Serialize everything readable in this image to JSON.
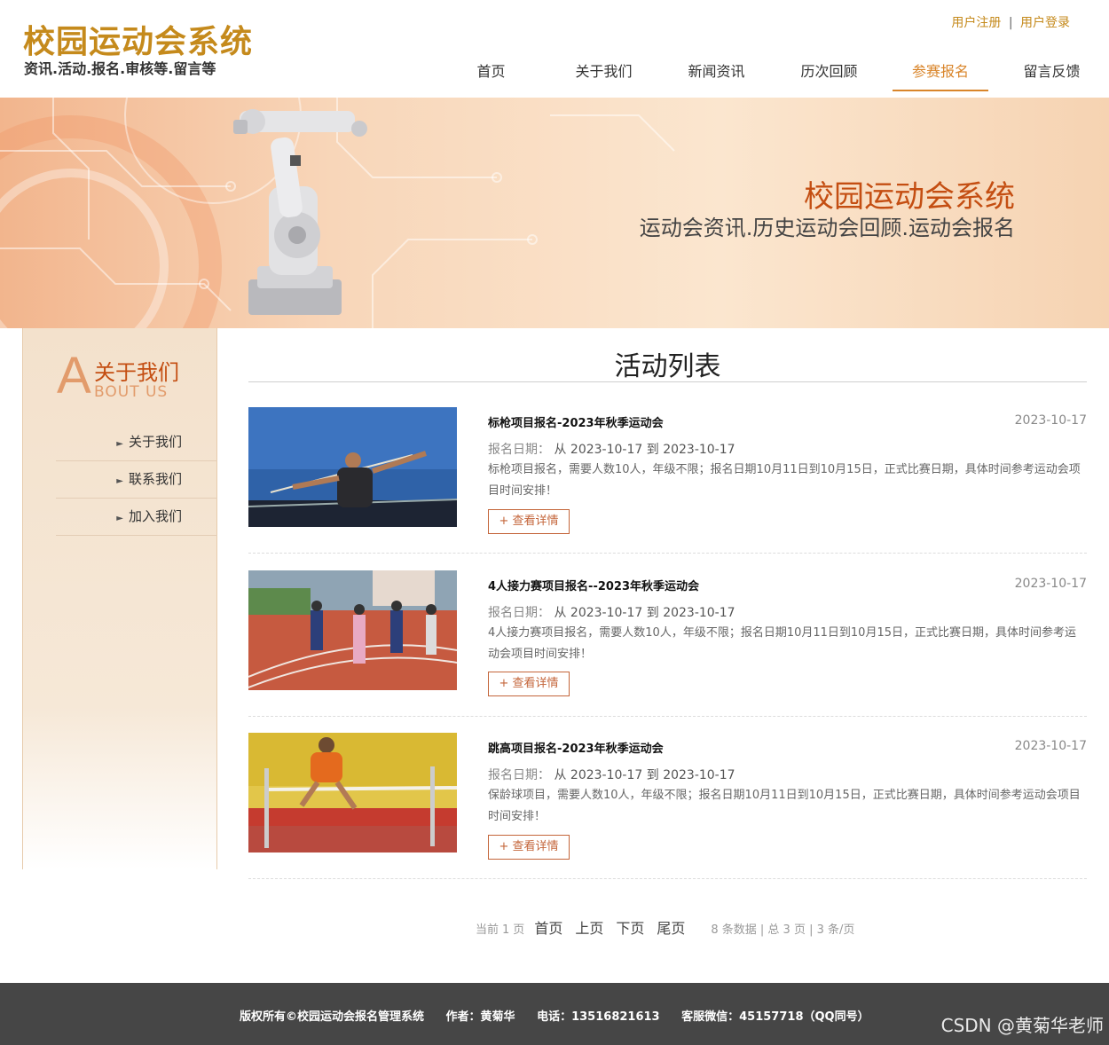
{
  "header": {
    "title": "校园运动会系统",
    "subtitle": "资讯.活动.报名.审核等.留言等",
    "links": {
      "register": "用户注册",
      "sep": "|",
      "login": "用户登录"
    },
    "nav": [
      "首页",
      "关于我们",
      "新闻资讯",
      "历次回顾",
      "参赛报名",
      "留言反馈"
    ],
    "active_nav": "参赛报名",
    "accent": "#d9852a"
  },
  "banner": {
    "title": "校园运动会系统",
    "subtitle": "运动会资讯.历史运动会回顾.运动会报名"
  },
  "sidebar": {
    "big_letter": "A",
    "heading_cn": "关于我们",
    "heading_en": "BOUT US",
    "items": [
      "关于我们",
      "联系我们",
      "加入我们"
    ]
  },
  "content": {
    "title": "活动列表",
    "period_label": "报名日期：",
    "from_label": "从",
    "to_label": "到",
    "detail_label": "+ 查看详情",
    "items": [
      {
        "title": "标枪项目报名-2023年秋季运动会",
        "date": "2023-10-17",
        "start": "2023-10-17",
        "end": "2023-10-17",
        "desc": "标枪项目报名，需要人数10人，年级不限；报名日期10月11日到10月15日，正式比赛日期，具体时间参考运动会项目时间安排！",
        "image": "javelin-photo"
      },
      {
        "title": "4人接力赛项目报名--2023年秋季运动会",
        "date": "2023-10-17",
        "start": "2023-10-17",
        "end": "2023-10-17",
        "desc": "4人接力赛项目报名，需要人数10人，年级不限；报名日期10月11日到10月15日，正式比赛日期，具体时间参考运动会项目时间安排！",
        "image": "relay-photo"
      },
      {
        "title": "跳高项目报名-2023年秋季运动会",
        "date": "2023-10-17",
        "start": "2023-10-17",
        "end": "2023-10-17",
        "desc": "保龄球项目，需要人数10人，年级不限；报名日期10月11日到10月15日，正式比赛日期，具体时间参考运动会项目时间安排！",
        "image": "high-jump-photo"
      }
    ]
  },
  "pager": {
    "current_prefix": "当前",
    "current": "1",
    "current_suffix": "页",
    "first": "首页",
    "prev": "上页",
    "next": "下页",
    "last": "尾页",
    "summary": "8 条数据 | 总 3 页 | 3 条/页"
  },
  "footer": {
    "copyright": "版权所有©校园运动会报名管理系统",
    "author": "作者：黄菊华",
    "phone": "电话：13516821613",
    "wechat": "客服微信：45157718（QQ同号）",
    "watermark": "CSDN @黄菊华老师"
  }
}
